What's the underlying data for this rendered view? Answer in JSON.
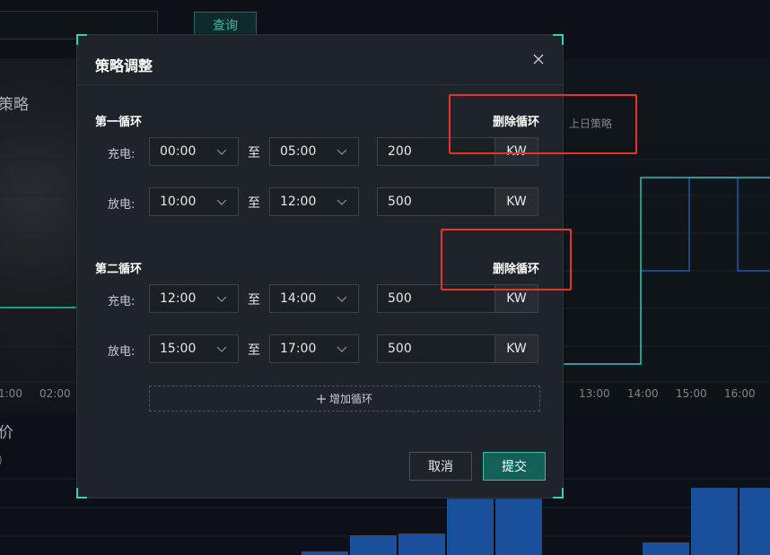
{
  "background": {
    "query_button": "查询",
    "strategy_title": "策略",
    "legend_label": "上日策略",
    "price_title": "价",
    "price_sub": ")",
    "x_ticks_left": [
      "1:00",
      "02:00"
    ],
    "x_ticks_right": [
      "13:00",
      "14:00",
      "15:00",
      "16:00"
    ],
    "colors": {
      "line_teal": "#2bbfae",
      "line_blue": "#1f5aa8",
      "bar_blue": "#1a4f9c"
    }
  },
  "modal": {
    "title": "策略调整",
    "close_icon": "close-icon",
    "cycles": [
      {
        "title": "第一循环",
        "delete_label": "删除循环",
        "rows": [
          {
            "label": "充电:",
            "start": "00:00",
            "to": "至",
            "end": "05:00",
            "power": "200",
            "unit": "KW"
          },
          {
            "label": "放电:",
            "start": "10:00",
            "to": "至",
            "end": "12:00",
            "power": "500",
            "unit": "KW"
          }
        ]
      },
      {
        "title": "第二循环",
        "delete_label": "删除循环",
        "rows": [
          {
            "label": "充电:",
            "start": "12:00",
            "to": "至",
            "end": "14:00",
            "power": "500",
            "unit": "KW"
          },
          {
            "label": "放电:",
            "start": "15:00",
            "to": "至",
            "end": "17:00",
            "power": "500",
            "unit": "KW"
          }
        ]
      }
    ],
    "add_cycle_label": "增加循环",
    "add_icon": "plus-icon",
    "cancel_label": "取消",
    "submit_label": "提交",
    "accent_color": "#33d1bd",
    "highlight_color": "#e8332c"
  }
}
